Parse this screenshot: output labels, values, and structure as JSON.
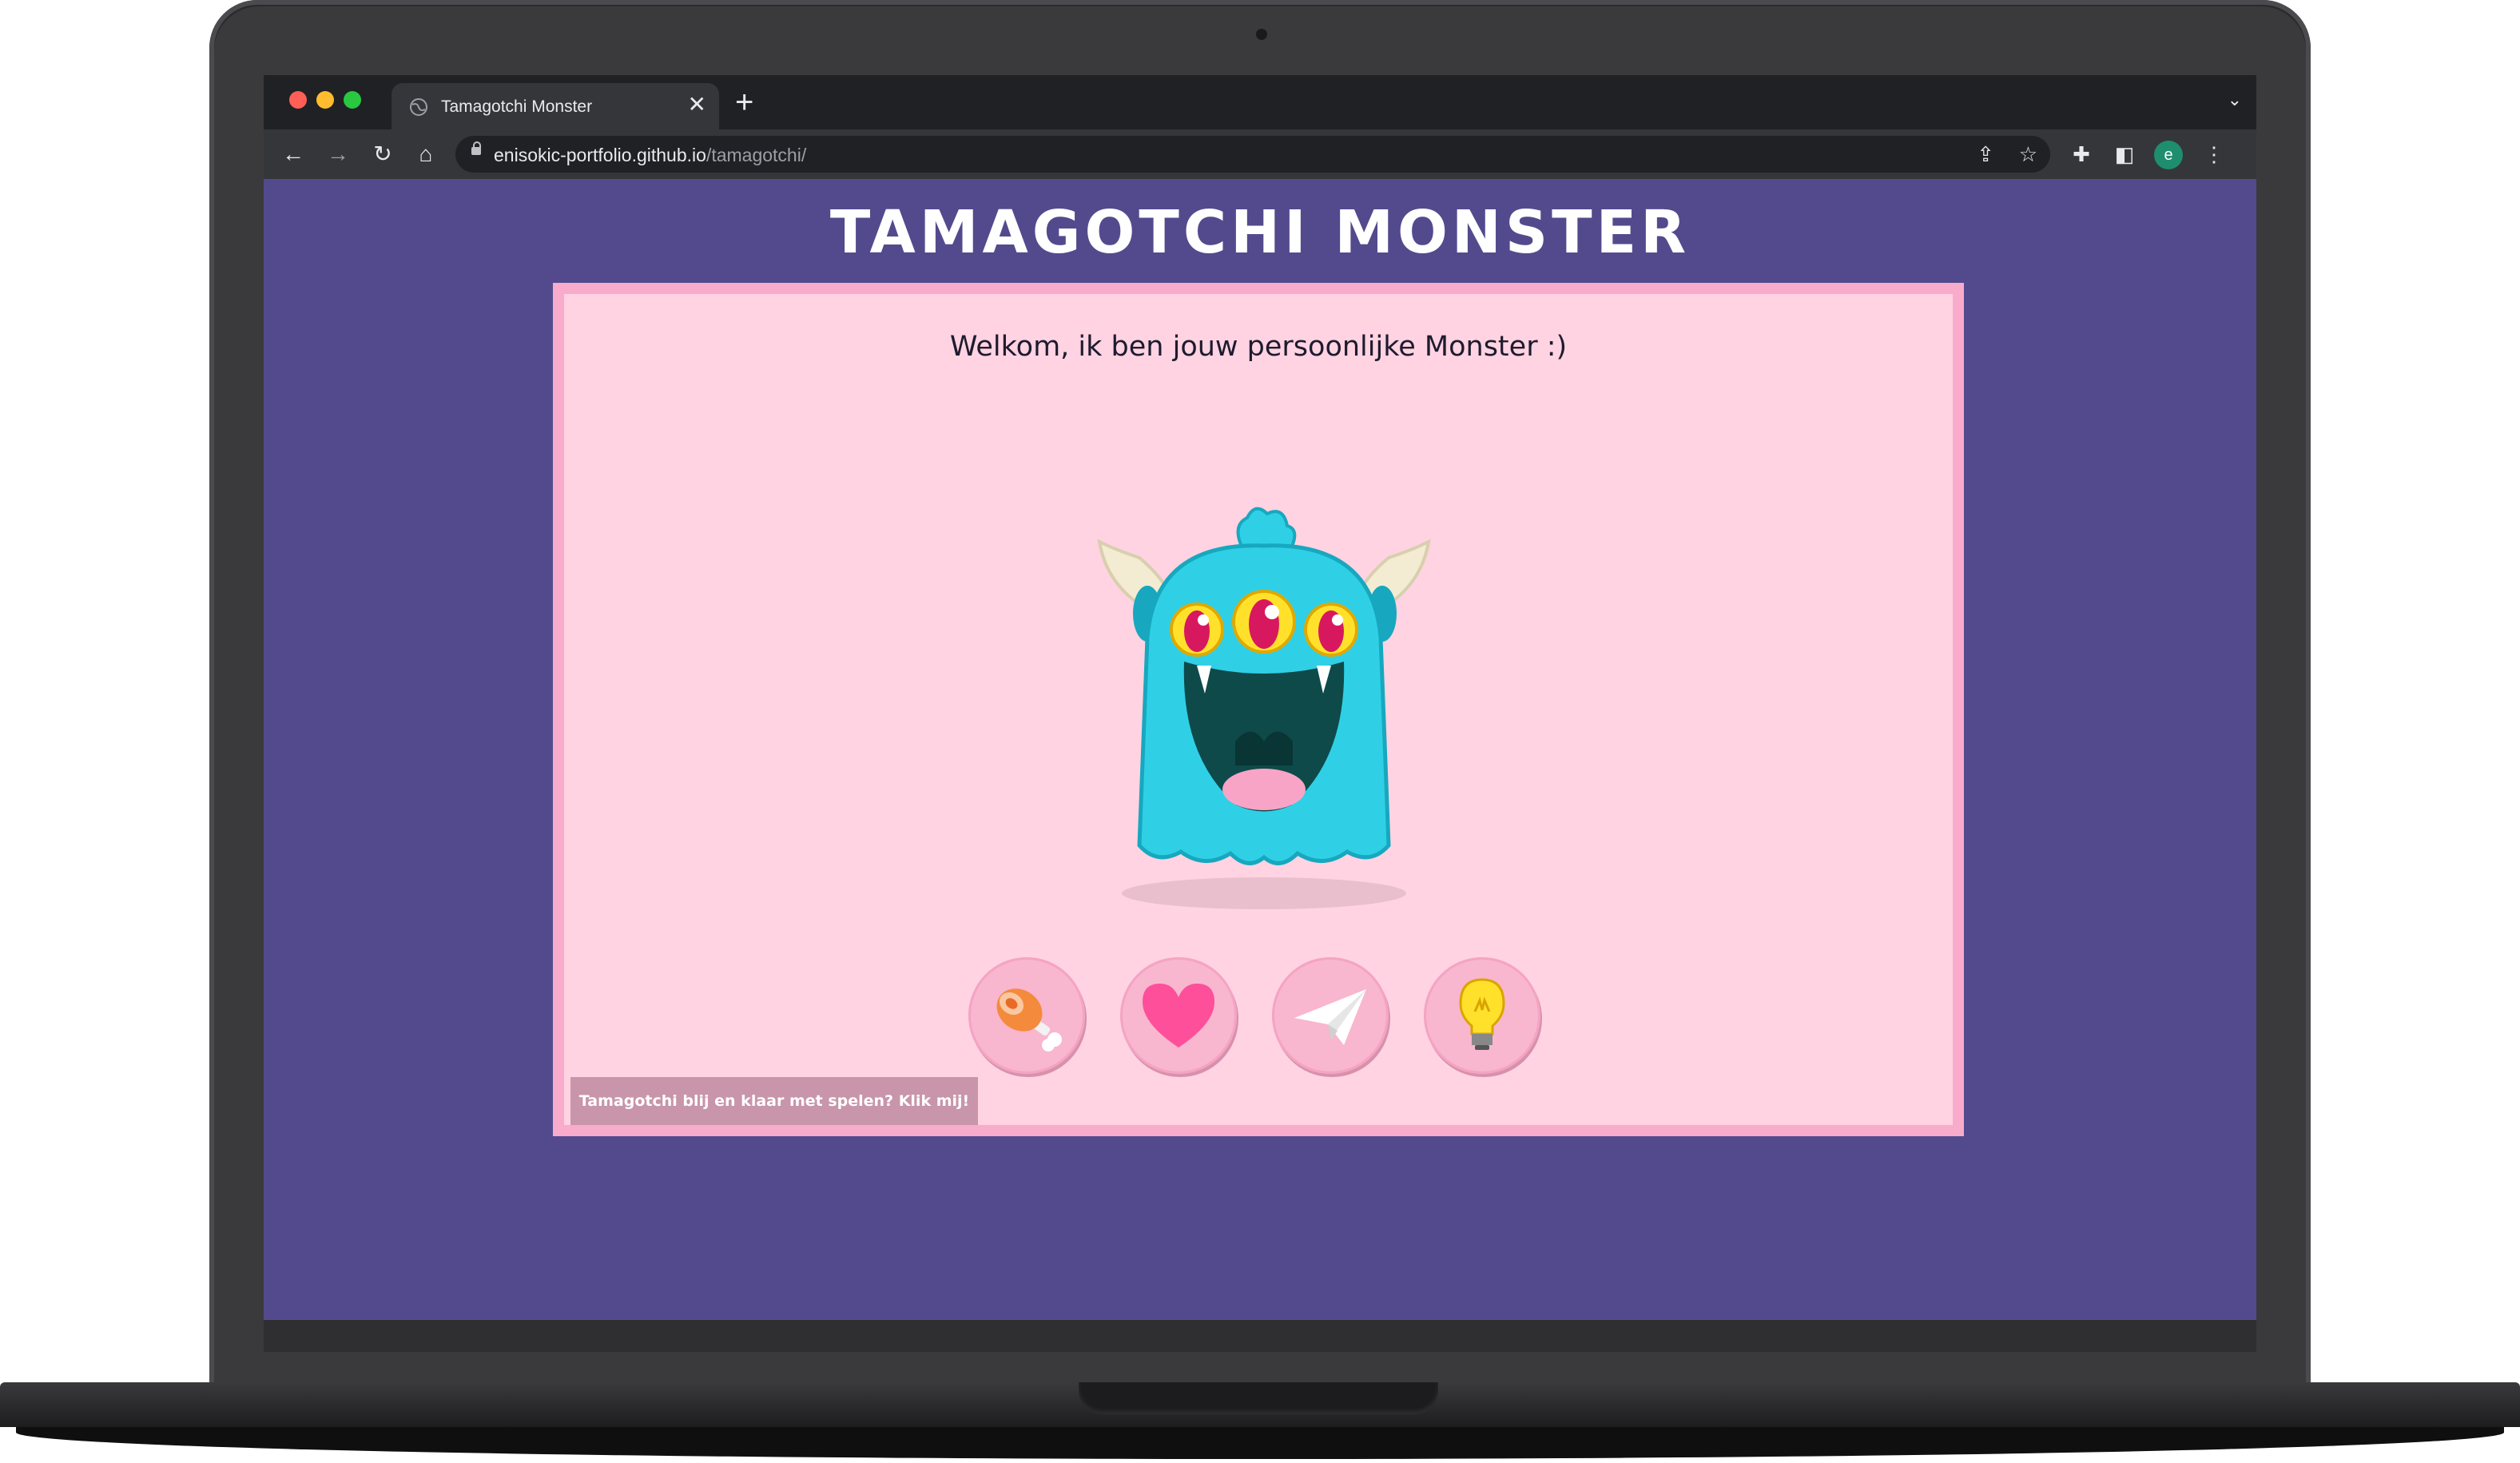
{
  "browser": {
    "tab_title": "Tamagotchi Monster",
    "tab_close": "✕",
    "new_tab": "+",
    "tab_menu": "⌄",
    "url_host": "enisokic-portfolio.github.io",
    "url_path": "/tamagotchi/",
    "profile_initial": "e",
    "nav": {
      "back": "←",
      "forward": "→",
      "reload": "↻",
      "home": "⌂"
    },
    "icons": {
      "share": "⇪",
      "star": "☆",
      "extensions": "✚",
      "sidebar": "◧",
      "menu": "⋮"
    }
  },
  "page": {
    "title": "TAMAGOTCHI MONSTER",
    "welcome": "Welkom, ik ben jouw persoonlijke Monster :)",
    "done_button": "Tamagotchi blij en klaar met spelen? Klik mij!",
    "actions": [
      {
        "name": "feed",
        "icon": "meat-icon"
      },
      {
        "name": "love",
        "icon": "heart-icon"
      },
      {
        "name": "play",
        "icon": "paper-plane-icon"
      },
      {
        "name": "learn",
        "icon": "lightbulb-icon"
      }
    ]
  },
  "colors": {
    "page_background": "#534a8d",
    "game_background": "#ffd3e2",
    "game_border": "#f9abcc",
    "monster_body": "#2fd0e6",
    "button_background": "#f9b6cf"
  }
}
